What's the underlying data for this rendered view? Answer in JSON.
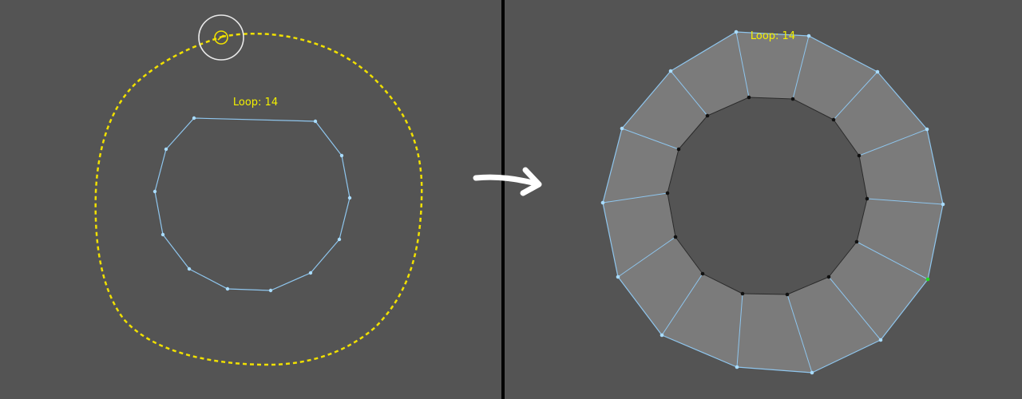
{
  "left_panel": {
    "loop_label": "Loop: 14"
  },
  "right_panel": {
    "loop_label": "Loop: 14"
  },
  "colors": {
    "background": "#545454",
    "divider": "#000000",
    "dashed_stroke": "#f0e000",
    "edge": "#8fc6ee",
    "face": "#7b7b7b",
    "inner_edge": "#2a2a2a",
    "vertex_selected": "#a9dcff",
    "vertex_inner": "#111111",
    "vertex_active": "#22dd22",
    "label": "#f3f000",
    "arrow": "#ffffff",
    "cursor_ring": "#e8e8e8"
  },
  "icons": {
    "cursor": "brush-cursor-icon",
    "arrow": "arrow-right-icon"
  }
}
